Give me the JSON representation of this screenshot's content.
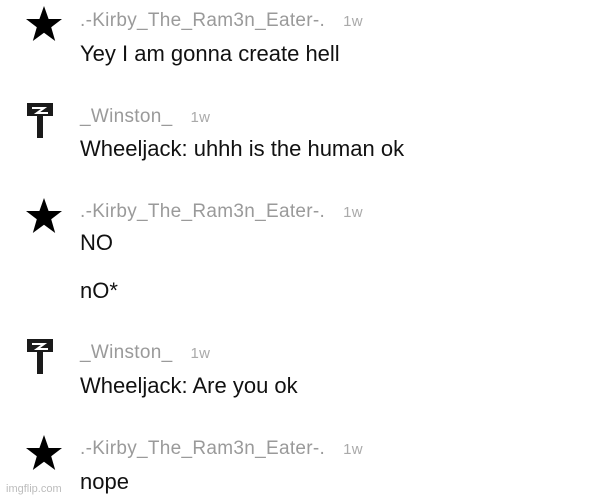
{
  "posts": [
    {
      "avatar_icon": "star-icon",
      "username": ".-Kirby_The_Ram3n_Eater-.",
      "time": "1w",
      "messages": [
        "Yey I am gonna create hell"
      ]
    },
    {
      "avatar_icon": "wrench-flag-icon",
      "username": "_Winston_",
      "time": "1w",
      "messages": [
        "Wheeljack: uhhh is the human ok"
      ]
    },
    {
      "avatar_icon": "star-icon",
      "username": ".-Kirby_The_Ram3n_Eater-.",
      "time": "1w",
      "messages": [
        "NO",
        "nO*"
      ]
    },
    {
      "avatar_icon": "wrench-flag-icon",
      "username": "_Winston_",
      "time": "1w",
      "messages": [
        "Wheeljack: Are you ok"
      ]
    },
    {
      "avatar_icon": "star-icon",
      "username": ".-Kirby_The_Ram3n_Eater-.",
      "time": "1w",
      "messages": [
        "nope"
      ]
    }
  ],
  "watermark": "imgflip.com"
}
